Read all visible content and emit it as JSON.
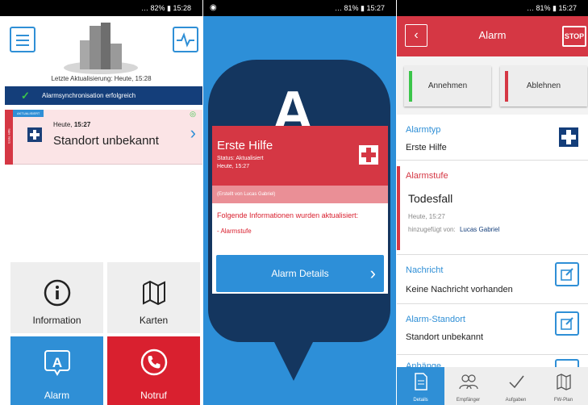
{
  "panel1": {
    "status_bar": "  … 82% ▮ 15:28",
    "last_update": "Letzte Aktualisierung: Heute, 15:28",
    "sync_message": "Alarmsynchronisation erfolgreich",
    "card": {
      "tag": "AKTUALISIERT",
      "side_label": "Erste Hilfe",
      "time_prefix": "Heute,",
      "time": "15:27",
      "location": "Standort unbekannt"
    },
    "tiles": {
      "info": "Information",
      "karten": "Karten",
      "alarm": "Alarm",
      "notruf": "Notruf"
    }
  },
  "panel2": {
    "status_bar": "… 81% ▮ 15:27",
    "title": "Erste Hilfe",
    "status": "Status: Aktualisiert",
    "date": "Heute, 15:27",
    "created_by": "(Erstellt von Lucas Gabriel)",
    "info": "Folgende Informationen wurden aktualisiert:",
    "item": "- Alarmstufe",
    "button": "Alarm Details"
  },
  "panel3": {
    "status_bar": "… 81% ▮ 15:27",
    "title": "Alarm",
    "stop": "STOP",
    "accept": "Annehmen",
    "decline": "Ablehnen",
    "alarmtyp_label": "Alarmtyp",
    "alarmtyp_value": "Erste Hilfe",
    "alarmstufe_label": "Alarmstufe",
    "alarmstufe_value": "Todesfall",
    "alarmstufe_time": "Heute, 15:27",
    "added_by_prefix": "hinzugefügt von:",
    "added_by": "Lucas Gabriel",
    "nachricht_label": "Nachricht",
    "nachricht_value": "Keine Nachricht vorhanden",
    "standort_label": "Alarm-Standort",
    "standort_value": "Standort unbekannt",
    "next_label": "Anhänge",
    "tabs": [
      "Details",
      "Empfänger",
      "Aufgaben",
      "FW-Plan"
    ]
  },
  "colors": {
    "blue": "#2f8fd6",
    "navy": "#143e7a",
    "red": "#d53744",
    "green": "#3bc54a"
  },
  "icons": [
    "menu-icon",
    "pulse-icon",
    "building-icon",
    "check-icon",
    "eye-icon",
    "medical-cross-icon",
    "chevron-right-icon",
    "info-icon",
    "map-icon",
    "alarm-bubble-icon",
    "phone-icon",
    "back-arrow-icon",
    "edit-icon",
    "document-icon",
    "people-icon",
    "checkmark-icon"
  ]
}
